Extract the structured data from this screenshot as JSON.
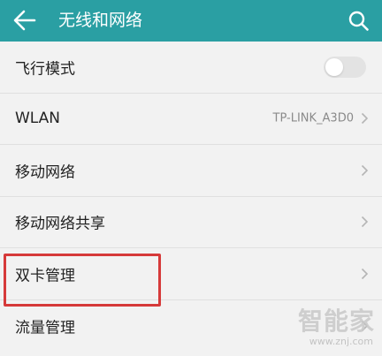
{
  "header": {
    "title": "无线和网络",
    "back_icon": "arrow-left-icon",
    "search_icon": "search-icon",
    "background_color": "#2a9fa3"
  },
  "rows": [
    {
      "label": "飞行模式",
      "control": "toggle",
      "toggle_on": false
    },
    {
      "label": "WLAN",
      "value": "TP-LINK_A3D0",
      "control": "chevron"
    },
    {
      "label": "移动网络",
      "control": "chevron"
    },
    {
      "label": "移动网络共享",
      "control": "chevron"
    },
    {
      "label": "双卡管理",
      "control": "chevron",
      "highlighted": true
    },
    {
      "label": "流量管理",
      "control": "chevron"
    }
  ],
  "highlight_color": "#d63a3a",
  "watermark": {
    "text": "智能家",
    "url": "www.znj.com"
  }
}
